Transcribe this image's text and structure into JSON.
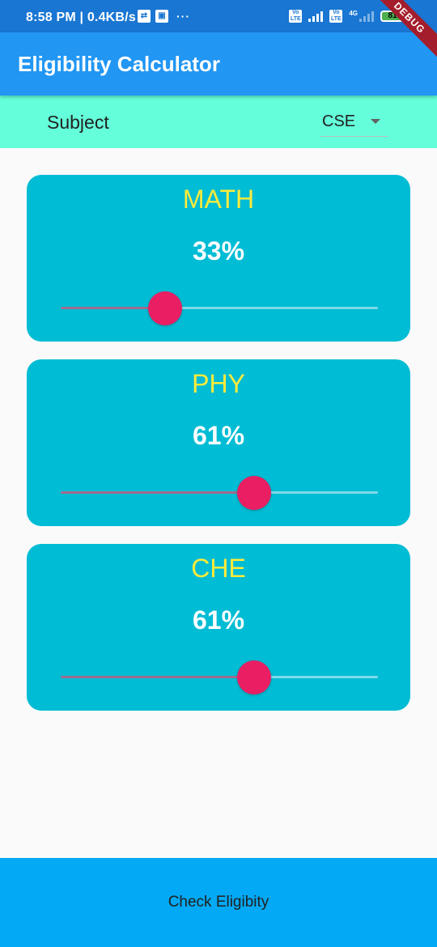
{
  "status_bar": {
    "time_speed": "8:58 PM | 0.4KB/s",
    "more_dots": "···",
    "network": "4G",
    "battery": "81"
  },
  "debug_banner": "DEBUG",
  "app_bar": {
    "title": "Eligibility Calculator"
  },
  "subject": {
    "label": "Subject",
    "selected": "CSE"
  },
  "cards": [
    {
      "name": "MATH",
      "value": "33%",
      "level": 0.33
    },
    {
      "name": "PHY",
      "value": "61%",
      "level": 0.61
    },
    {
      "name": "CHE",
      "value": "61%",
      "level": 0.61
    }
  ],
  "colors": {
    "app_bar": "#2196f3",
    "status_bar": "#1976d2",
    "subject_row": "#64ffda",
    "card": "#00bcd4",
    "card_title": "#ffeb3b",
    "thumb": "#e91e63",
    "button": "#03a9f4"
  },
  "icons": {
    "usb": "usb-icon",
    "image": "image-icon",
    "volte": "volte-icon",
    "signal": "signal-icon",
    "battery": "battery-icon",
    "dropdown": "dropdown-arrow-icon"
  },
  "actions": {
    "check_label": "Check Eligibity"
  }
}
